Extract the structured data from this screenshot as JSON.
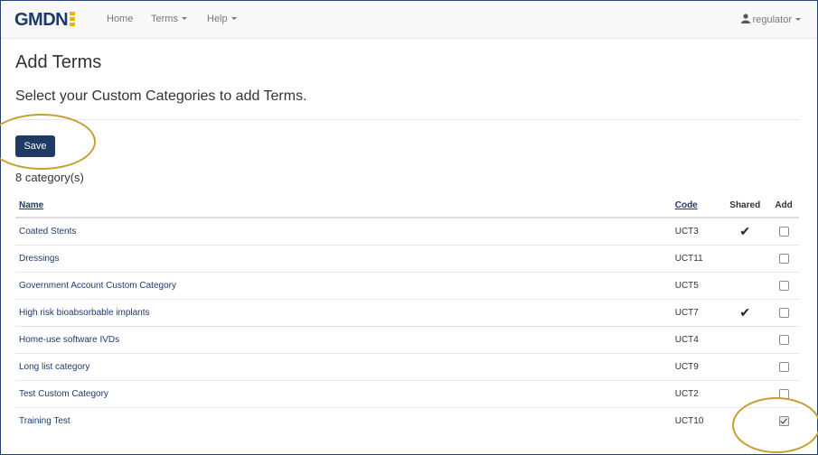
{
  "navbar": {
    "brand": "GMDN",
    "home": "Home",
    "terms": "Terms",
    "help": "Help",
    "user": "regulator"
  },
  "page": {
    "title": "Add Terms",
    "subtitle": "Select your Custom Categories to add Terms.",
    "save_label": "Save",
    "count": "8 category(s)"
  },
  "table": {
    "headers": {
      "name": "Name",
      "code": "Code",
      "shared": "Shared",
      "add": "Add"
    },
    "rows": [
      {
        "name": "Coated Stents",
        "code": "UCT3",
        "shared": true,
        "add": false
      },
      {
        "name": "Dressings",
        "code": "UCT11",
        "shared": false,
        "add": false
      },
      {
        "name": "Government Account Custom Category",
        "code": "UCT5",
        "shared": false,
        "add": false
      },
      {
        "name": "High risk bioabsorbable implants",
        "code": "UCT7",
        "shared": true,
        "add": false
      },
      {
        "name": "Home-use software IVDs",
        "code": "UCT4",
        "shared": false,
        "add": false
      },
      {
        "name": "Long list category",
        "code": "UCT9",
        "shared": false,
        "add": false
      },
      {
        "name": "Test Custom Category",
        "code": "UCT2",
        "shared": false,
        "add": false
      },
      {
        "name": "Training Test",
        "code": "UCT10",
        "shared": false,
        "add": true
      }
    ]
  },
  "colors": {
    "brand": "#1f3a68",
    "accent": "#f0b400",
    "annotation": "#c3a02e"
  },
  "icons": {
    "user": "user-icon",
    "shared": "checkmark-icon"
  }
}
